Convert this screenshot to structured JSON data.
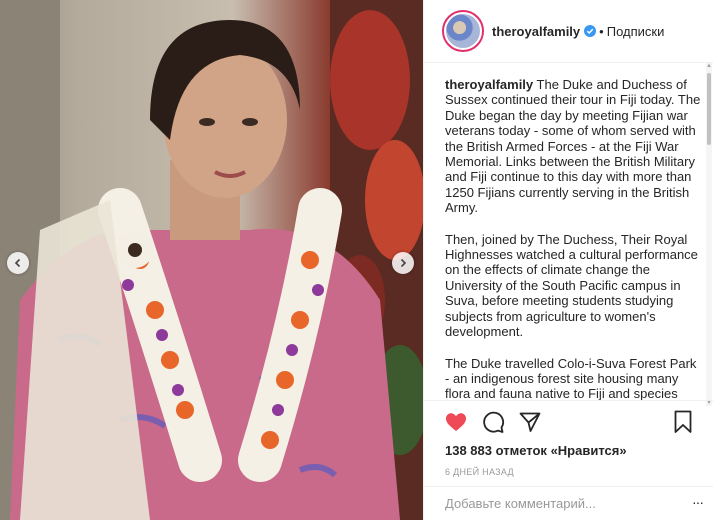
{
  "post": {
    "photo_alt": "",
    "account": {
      "username": "theroyalfamily",
      "verified": true,
      "separator": "•",
      "follow_label": "Подписки"
    },
    "caption": {
      "username": "theroyalfamily",
      "paragraphs": [
        " The Duke and Duchess of Sussex continued their tour in Fiji today. The Duke began the day by meeting Fijian war veterans today - some of whom served with the British Armed Forces - at the Fiji War Memorial. Links between the British Military and Fiji continue to this day with more than 1250 Fijians currently serving in the British Army.",
        "Then, joined by The Duchess, Their Royal Highnesses watched a cultural performance on the effects of climate change the University of the South Pacific campus in Suva, before meeting students studying subjects from agriculture to women's development.",
        "The Duke travelled Colo-i-Suva Forest Park - an indigenous forest site housing many flora and fauna native to Fiji and species"
      ]
    },
    "likes": {
      "count": "138 883",
      "label": "отметок",
      "quoted": "«Нравится»"
    },
    "timestamp": "6 дней назад",
    "comment_placeholder": "Добавьте комментарий...",
    "more_label": "···"
  },
  "colors": {
    "like_heart": "#ed4956",
    "verified_badge": "#3897f0",
    "timestamp": "#999999"
  }
}
